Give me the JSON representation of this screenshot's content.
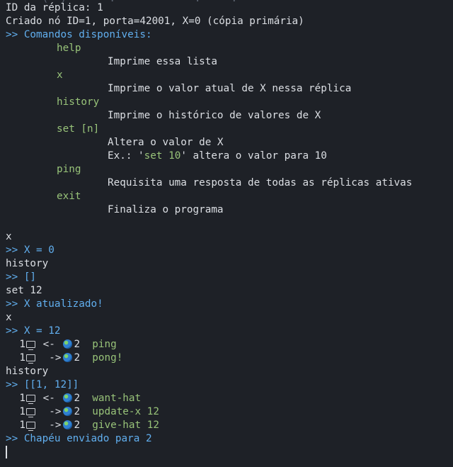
{
  "top_partial": "-  -  (  ) ~  ~  .  -  -  - ~  .  ~  .  ~  -",
  "intro": {
    "replica_id": "ID da réplica: 1",
    "created": "Criado nó ID=1, porta=42001, X=0 (cópia primária)",
    "commands_header": ">> Comandos disponíveis:"
  },
  "commands": [
    {
      "name": "help",
      "desc": [
        "Imprime essa lista"
      ]
    },
    {
      "name": "x",
      "desc": [
        "Imprime o valor atual de X nessa réplica"
      ]
    },
    {
      "name": "history",
      "desc": [
        "Imprime o histórico de valores de X"
      ]
    },
    {
      "name": "set [n]",
      "desc": [
        "Altera o valor de X"
      ],
      "example": {
        "pre": "Ex.: '",
        "code": "set 10",
        "post": "' altera o valor para 10"
      }
    },
    {
      "name": "ping",
      "desc": [
        "Requisita uma resposta de todas as réplicas ativas"
      ]
    },
    {
      "name": "exit",
      "desc": [
        "Finaliza o programa"
      ]
    }
  ],
  "session": {
    "cmd_x_1": "x",
    "out_x_1": ">> X = 0",
    "cmd_history_1": "history",
    "out_history_1": ">> []",
    "cmd_set": "set 12",
    "out_set": ">> X atualizado!",
    "cmd_x_2": "x",
    "out_x_2": ">> X = 12",
    "cmd_history_2": "history",
    "out_history_2": ">> [[1, 12]]",
    "out_hat": ">> Chapéu enviado para 2"
  },
  "messages_1": [
    {
      "from": "1",
      "arrow": "<-",
      "to": "2",
      "text": "ping"
    },
    {
      "from": "1",
      "arrow": "->",
      "to": "2",
      "text": "pong!"
    }
  ],
  "messages_2": [
    {
      "from": "1",
      "arrow": "<-",
      "to": "2",
      "text": "want-hat"
    },
    {
      "from": "1",
      "arrow": "->",
      "to": "2",
      "text": "update-x 12"
    },
    {
      "from": "1",
      "arrow": "->",
      "to": "2",
      "text": "give-hat 12"
    }
  ],
  "icons": {
    "local": "computer-icon",
    "remote": "globe-icon"
  },
  "colors": {
    "background": "#1e2127",
    "text": "#dcdfe4",
    "prompt_blue": "#61afef",
    "command_green": "#98c379"
  }
}
